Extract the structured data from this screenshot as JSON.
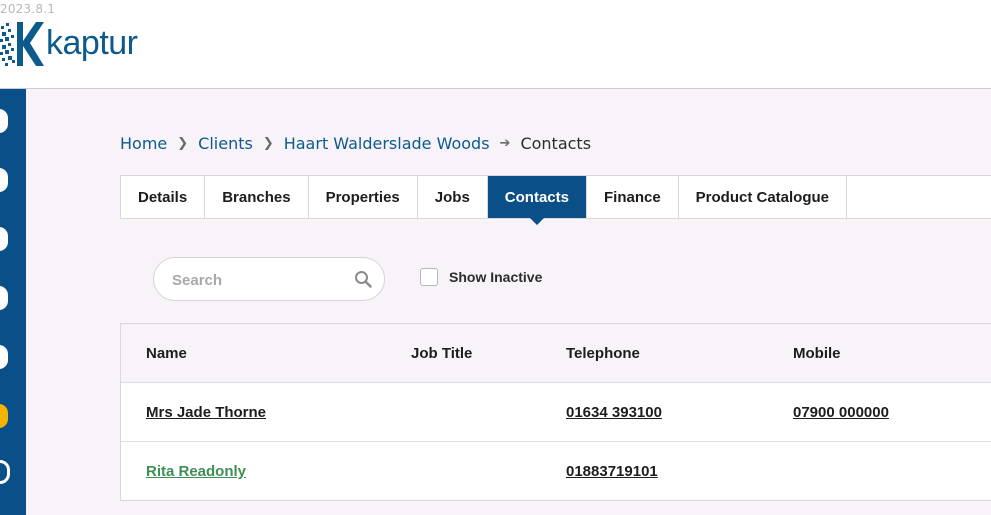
{
  "app": {
    "version": "2023.8.1",
    "logo_text": "kaptur"
  },
  "breadcrumb": {
    "items": [
      "Home",
      "Clients",
      "Haart Walderslade Woods"
    ],
    "current": "Contacts"
  },
  "tabs": [
    {
      "label": "Details",
      "active": false
    },
    {
      "label": "Branches",
      "active": false
    },
    {
      "label": "Properties",
      "active": false
    },
    {
      "label": "Jobs",
      "active": false
    },
    {
      "label": "Contacts",
      "active": true
    },
    {
      "label": "Finance",
      "active": false
    },
    {
      "label": "Product Catalogue",
      "active": false
    }
  ],
  "filters": {
    "search_placeholder": "Search",
    "search_value": "",
    "show_inactive_label": "Show Inactive",
    "show_inactive_checked": false
  },
  "table": {
    "columns": [
      "Name",
      "Job Title",
      "Telephone",
      "Mobile"
    ],
    "rows": [
      {
        "name": "Mrs Jade Thorne",
        "job_title": "",
        "telephone": "01634 393100",
        "mobile": "07900 000000"
      },
      {
        "name": "Rita Readonly",
        "job_title": "",
        "telephone": "01883719101",
        "mobile": ""
      }
    ]
  },
  "colors": {
    "brand_blue": "#0a4f87",
    "link_blue": "#0d5a8c",
    "alert_yellow": "#f5b400",
    "readonly_green": "#3f8f55"
  },
  "sidebar": {
    "icons": [
      "nav-icon",
      "nav-icon",
      "nav-icon",
      "nav-icon",
      "nav-icon",
      "alert-icon",
      "settings-icon"
    ]
  }
}
